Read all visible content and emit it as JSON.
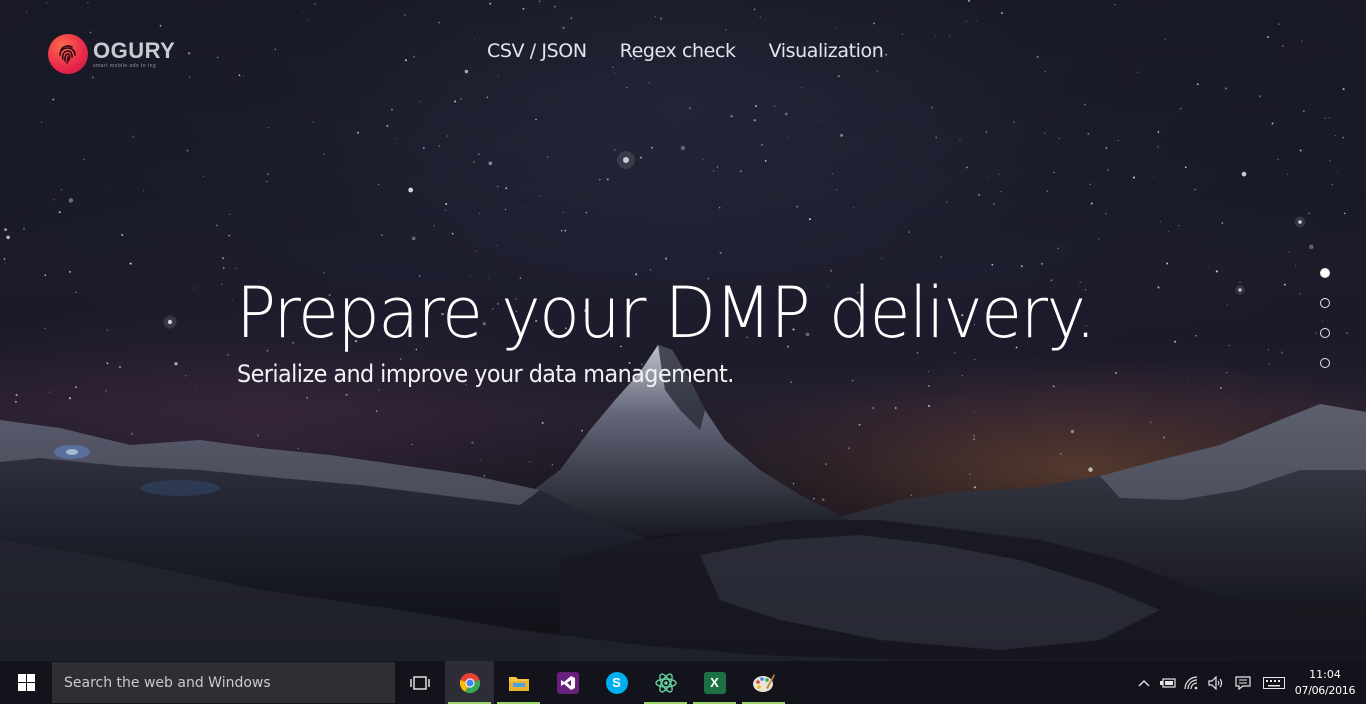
{
  "brand": {
    "name": "OGURY",
    "tagline": "smart mobile ads to ing",
    "color": "#e8264a"
  },
  "nav": {
    "items": [
      {
        "label": "CSV / JSON"
      },
      {
        "label": "Regex check"
      },
      {
        "label": "Visualization"
      }
    ]
  },
  "hero": {
    "title": "Prepare your DMP delivery.",
    "subtitle": "Serialize and improve your data management.",
    "slides": {
      "count": 4,
      "active": 1
    }
  },
  "taskbar": {
    "start_icon": "windows-logo-icon",
    "search_placeholder": "Search the web and Windows",
    "taskview_icon": "task-view-icon",
    "apps": [
      {
        "name": "chrome",
        "icon": "chrome-icon",
        "active": true,
        "color": "#e94235"
      },
      {
        "name": "file-explorer",
        "icon": "folder-icon",
        "active": false,
        "color": "#f4c542"
      },
      {
        "name": "visual-studio",
        "icon": "visual-studio-icon",
        "active": false,
        "color": "#68217a"
      },
      {
        "name": "skype",
        "icon": "skype-icon",
        "active": false,
        "color": "#00aff0"
      },
      {
        "name": "atom",
        "icon": "atom-icon",
        "active": false,
        "color": "#66d19e"
      },
      {
        "name": "excel",
        "icon": "excel-icon",
        "active": false,
        "color": "#1d7044"
      },
      {
        "name": "paint",
        "icon": "paint-icon",
        "active": false,
        "color": "#f0a030"
      }
    ],
    "tray": {
      "icons": [
        "chevron-up-icon",
        "power-icon",
        "wifi-icon",
        "volume-icon",
        "notification-icon",
        "keyboard-icon"
      ],
      "time": "11:04",
      "date": "07/06/2016"
    }
  }
}
